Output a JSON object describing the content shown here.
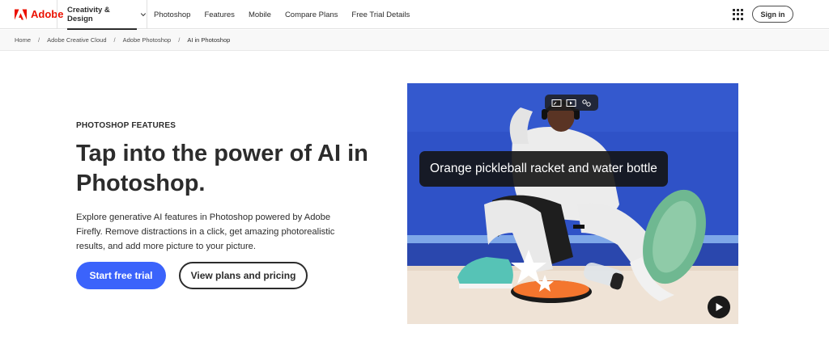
{
  "nav": {
    "logo": "Adobe",
    "category": "Creativity & Design",
    "links": [
      "Photoshop",
      "Features",
      "Mobile",
      "Compare Plans",
      "Free Trial Details"
    ],
    "sign_in": "Sign in"
  },
  "breadcrumb": {
    "items": [
      "Home",
      "Adobe Creative Cloud",
      "Adobe Photoshop"
    ],
    "current": "AI in Photoshop",
    "separator": "/"
  },
  "hero": {
    "eyebrow": "PHOTOSHOP FEATURES",
    "headline": "Tap into the power of AI in Photoshop.",
    "description": "Explore generative AI features in Photoshop powered by Adobe Firefly. Remove distractions in a click, get amazing photorealistic results, and add more picture to your picture.",
    "primary_cta": "Start free trial",
    "secondary_cta": "View plans and pricing"
  },
  "media": {
    "caption": "Orange pickleball racket and water bottle",
    "toolbar_icons": [
      "generative-fill-icon",
      "generative-expand-icon",
      "remove-tool-icon"
    ],
    "play_icon": "play-icon"
  },
  "colors": {
    "brand": "#eb1000",
    "primary_button": "#3b63fb",
    "wall_blue": "#2f52c7"
  }
}
